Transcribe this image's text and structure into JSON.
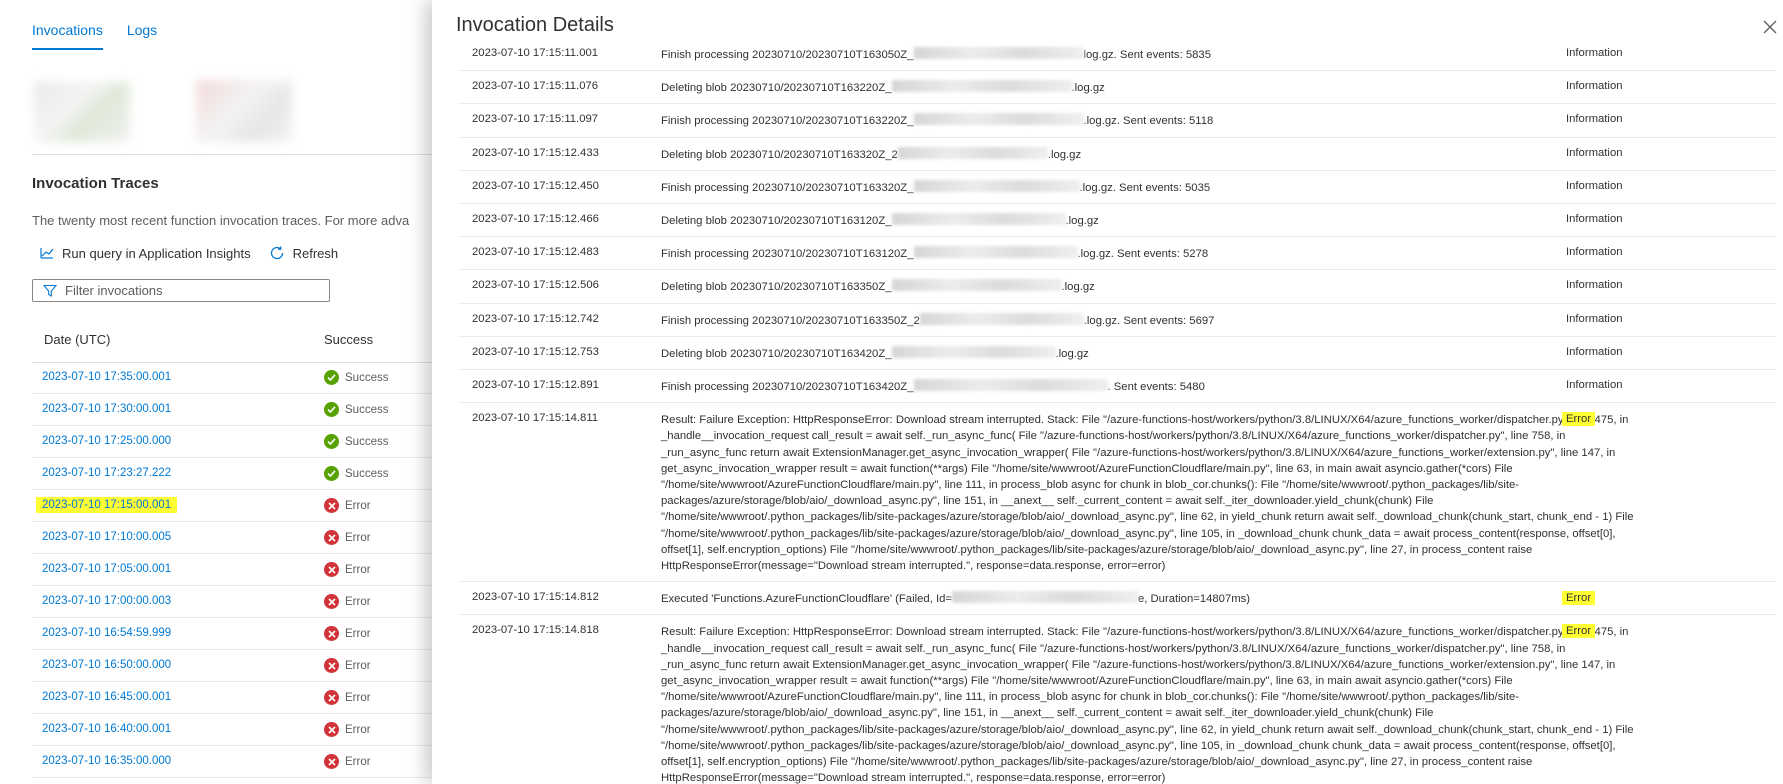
{
  "left": {
    "tabs": [
      {
        "label": "Invocations",
        "active": true
      },
      {
        "label": "Logs",
        "active": false
      }
    ],
    "section_title": "Invocation Traces",
    "description": "The twenty most recent function invocation traces. For more adva",
    "commands": {
      "run_query": "Run query in Application Insights",
      "refresh": "Refresh"
    },
    "filter_placeholder": "Filter invocations",
    "columns": {
      "date": "Date (UTC)",
      "success": "Success"
    },
    "rows": [
      {
        "date": "2023-07-10 17:35:00.001",
        "status": "Success"
      },
      {
        "date": "2023-07-10 17:30:00.001",
        "status": "Success"
      },
      {
        "date": "2023-07-10 17:25:00.000",
        "status": "Success"
      },
      {
        "date": "2023-07-10 17:23:27.222",
        "status": "Success"
      },
      {
        "date": "2023-07-10 17:15:00.001",
        "status": "Error",
        "highlighted": true
      },
      {
        "date": "2023-07-10 17:10:00.005",
        "status": "Error"
      },
      {
        "date": "2023-07-10 17:05:00.001",
        "status": "Error"
      },
      {
        "date": "2023-07-10 17:00:00.003",
        "status": "Error"
      },
      {
        "date": "2023-07-10 16:54:59.999",
        "status": "Error"
      },
      {
        "date": "2023-07-10 16:50:00.000",
        "status": "Error"
      },
      {
        "date": "2023-07-10 16:45:00.001",
        "status": "Error"
      },
      {
        "date": "2023-07-10 16:40:00.001",
        "status": "Error"
      },
      {
        "date": "2023-07-10 16:35:00.000",
        "status": "Error"
      }
    ]
  },
  "panel": {
    "title": "Invocation Details",
    "logs": [
      {
        "ts": "2023-07-10 17:15:11.001",
        "pre": "Finish processing 20230710/20230710T163050Z_",
        "post": "log.gz. Sent events: 5835",
        "level": "Information"
      },
      {
        "ts": "2023-07-10 17:15:11.076",
        "pre": "Deleting blob 20230710/20230710T163220Z_",
        "post": ".log.gz",
        "level": "Information"
      },
      {
        "ts": "2023-07-10 17:15:11.097",
        "pre": "Finish processing 20230710/20230710T163220Z_",
        "post": ".log.gz. Sent events: 5118",
        "level": "Information"
      },
      {
        "ts": "2023-07-10 17:15:12.433",
        "pre": "Deleting blob 20230710/20230710T163320Z_2",
        "post": ".log.gz",
        "level": "Information"
      },
      {
        "ts": "2023-07-10 17:15:12.450",
        "pre": "Finish processing 20230710/20230710T163320Z_",
        "post": ".log.gz. Sent events: 5035",
        "level": "Information"
      },
      {
        "ts": "2023-07-10 17:15:12.466",
        "pre": "Deleting blob 20230710/20230710T163120Z_",
        "post": ".log.gz",
        "level": "Information"
      },
      {
        "ts": "2023-07-10 17:15:12.483",
        "pre": "Finish processing 20230710/20230710T163120Z_",
        "post": ".log.gz. Sent events: 5278",
        "level": "Information"
      },
      {
        "ts": "2023-07-10 17:15:12.506",
        "pre": "Deleting blob 20230710/20230710T163350Z_",
        "post": ".log.gz",
        "level": "Information"
      },
      {
        "ts": "2023-07-10 17:15:12.742",
        "pre": "Finish processing 20230710/20230710T163350Z_2",
        "post": ".log.gz. Sent events: 5697",
        "level": "Information"
      },
      {
        "ts": "2023-07-10 17:15:12.753",
        "pre": "Deleting blob 20230710/20230710T163420Z_",
        "post": ".log.gz",
        "level": "Information"
      },
      {
        "ts": "2023-07-10 17:15:12.891",
        "pre": "Finish processing 20230710/20230710T163420Z_",
        "post": ". Sent events: 5480",
        "level": "Information"
      },
      {
        "ts": "2023-07-10 17:15:14.811",
        "text": "Result: Failure Exception: HttpResponseError: Download stream interrupted. Stack: File \"/azure-functions-host/workers/python/3.8/LINUX/X64/azure_functions_worker/dispatcher.py\", line 475, in _handle__invocation_request call_result = await self._run_async_func( File \"/azure-functions-host/workers/python/3.8/LINUX/X64/azure_functions_worker/dispatcher.py\", line 758, in _run_async_func return await ExtensionManager.get_async_invocation_wrapper( File \"/azure-functions-host/workers/python/3.8/LINUX/X64/azure_functions_worker/extension.py\", line 147, in get_async_invocation_wrapper result = await function(**args) File \"/home/site/wwwroot/AzureFunctionCloudflare/main.py\", line 63, in main await asyncio.gather(*cors) File \"/home/site/wwwroot/AzureFunctionCloudflare/main.py\", line 111, in process_blob async for chunk in blob_cor.chunks(): File \"/home/site/wwwroot/.python_packages/lib/site-packages/azure/storage/blob/aio/_download_async.py\", line 151, in __anext__ self._current_content = await self._iter_downloader.yield_chunk(chunk) File \"/home/site/wwwroot/.python_packages/lib/site-packages/azure/storage/blob/aio/_download_async.py\", line 62, in yield_chunk return await self._download_chunk(chunk_start, chunk_end - 1) File \"/home/site/wwwroot/.python_packages/lib/site-packages/azure/storage/blob/aio/_download_async.py\", line 105, in _download_chunk chunk_data = await process_content(response, offset[0], offset[1], self.encryption_options) File \"/home/site/wwwroot/.python_packages/lib/site-packages/azure/storage/blob/aio/_download_async.py\", line 27, in process_content raise HttpResponseError(message=\"Download stream interrupted.\", response=data.response, error=error)",
        "level": "Error"
      },
      {
        "ts": "2023-07-10 17:15:14.812",
        "pre": "Executed 'Functions.AzureFunctionCloudflare' (Failed, Id=",
        "post": "e, Duration=14807ms)",
        "level": "Error"
      },
      {
        "ts": "2023-07-10 17:15:14.818",
        "text": "Result: Failure Exception: HttpResponseError: Download stream interrupted. Stack: File \"/azure-functions-host/workers/python/3.8/LINUX/X64/azure_functions_worker/dispatcher.py\", line 475, in _handle__invocation_request call_result = await self._run_async_func( File \"/azure-functions-host/workers/python/3.8/LINUX/X64/azure_functions_worker/dispatcher.py\", line 758, in _run_async_func return await ExtensionManager.get_async_invocation_wrapper( File \"/azure-functions-host/workers/python/3.8/LINUX/X64/azure_functions_worker/extension.py\", line 147, in get_async_invocation_wrapper result = await function(**args) File \"/home/site/wwwroot/AzureFunctionCloudflare/main.py\", line 63, in main await asyncio.gather(*cors) File \"/home/site/wwwroot/AzureFunctionCloudflare/main.py\", line 111, in process_blob async for chunk in blob_cor.chunks(): File \"/home/site/wwwroot/.python_packages/lib/site-packages/azure/storage/blob/aio/_download_async.py\", line 151, in __anext__ self._current_content = await self._iter_downloader.yield_chunk(chunk) File \"/home/site/wwwroot/.python_packages/lib/site-packages/azure/storage/blob/aio/_download_async.py\", line 62, in yield_chunk return await self._download_chunk(chunk_start, chunk_end - 1) File \"/home/site/wwwroot/.python_packages/lib/site-packages/azure/storage/blob/aio/_download_async.py\", line 105, in _download_chunk chunk_data = await process_content(response, offset[0], offset[1], self.encryption_options) File \"/home/site/wwwroot/.python_packages/lib/site-packages/azure/storage/blob/aio/_download_async.py\", line 27, in process_content raise HttpResponseError(message=\"Download stream interrupted.\", response=data.response, error=error)",
        "level": "Error"
      }
    ]
  },
  "colors": {
    "accent": "#0078d4",
    "success": "#57a300",
    "error": "#d13438",
    "highlight": "#ffff33"
  },
  "icons": [
    "chart-line-icon",
    "refresh-icon",
    "filter-icon",
    "success-check-icon",
    "error-x-icon",
    "close-icon"
  ]
}
